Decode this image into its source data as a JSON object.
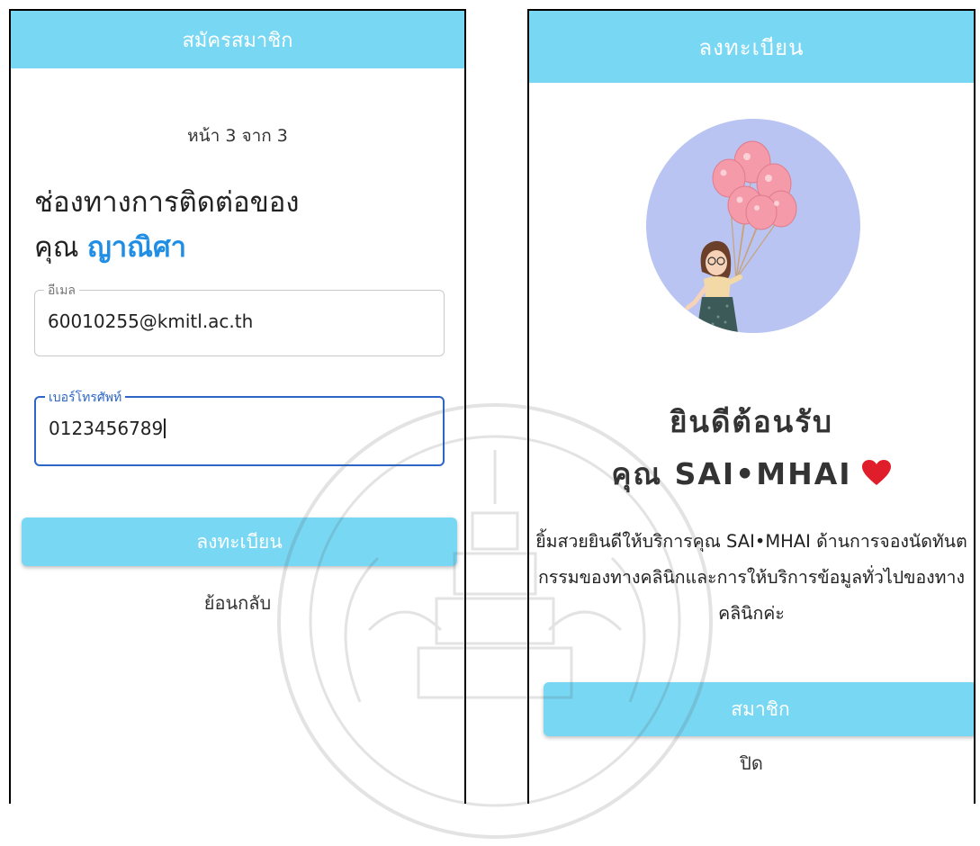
{
  "left_screen": {
    "header_title": "สมัครสมาชิก",
    "step_text": "หน้า 3 จาก 3",
    "title_line1": "ช่องทางการติดต่อของ",
    "title_prefix": "คุณ",
    "title_name": "ญาณิศา",
    "email": {
      "label": "อีเมล",
      "value": "60010255@kmitl.ac.th"
    },
    "phone": {
      "label": "เบอร์โทรศัพท์",
      "value": "0123456789"
    },
    "register_button": "ลงทะเบียน",
    "back_link": "ย้อนกลับ"
  },
  "right_screen": {
    "header_title": "ลงทะเบียน",
    "welcome_line1": "ยินดีต้อนรับ",
    "welcome_line2": "คุณ SAI•MHAI",
    "description": "ยิ้มสวยยินดีให้บริการคุณ SAI•MHAI ด้านการจองนัดทันตกรรมของทางคลินิกและการให้บริการข้อมูลทั่วไปของทางคลินิกค่ะ",
    "member_button": "สมาชิก",
    "close_link": "ปิด"
  },
  "icons": {
    "heart": "heart-icon",
    "avatar": "woman-with-balloons-illustration"
  },
  "colors": {
    "header_bg": "#78d7f3",
    "accent_name": "#1f8ee4",
    "focus_border": "#2d66c6",
    "heart": "#e01e2b"
  }
}
